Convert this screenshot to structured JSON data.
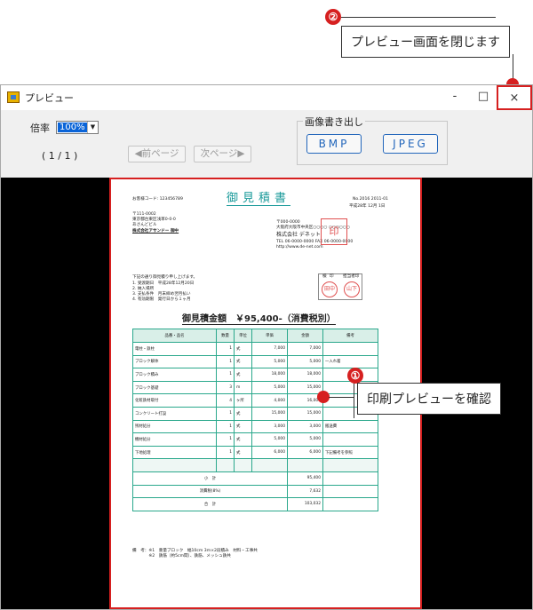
{
  "callouts": [
    {
      "number": "②",
      "text": "プレビュー画面を閉じます"
    },
    {
      "number": "①",
      "text": "印刷プレビューを確認"
    }
  ],
  "window": {
    "title": "プレビュー",
    "controls": {
      "minimize": "-",
      "maximize": "□",
      "close": "×"
    }
  },
  "toolbar": {
    "zoom_label": "倍率",
    "zoom_value": "100%",
    "page_indicator": "( 1 / 1 )",
    "prev_button": "◀前ページ",
    "next_button": "次ページ▶",
    "export_group_title": "画像書き出し",
    "bmp_button": "BMP",
    "jpeg_button": "JPEG"
  },
  "document": {
    "title": "御見積書",
    "customer_code": "お客様コード: 123456789",
    "doc_number": "No.2016 2011-01",
    "date": "平成28年 12月 1日",
    "customer_address": [
      "〒111-0002",
      "東京都台東区浅草0-0-0",
      "あさんどビル",
      "株式会社アサンドー 御中"
    ],
    "company_info": [
      "〒000-0000",
      "大阪府大阪市中央区○○○○ ○○○○○○",
      "株式会社 デネット",
      "TEL 06-0000-0000 FAX 06-0000-0000",
      "http://www.de-net.com"
    ],
    "company_stamp": "印",
    "intro": "下記の通り御見積り申し上げます。",
    "conditions": [
      "1. 受渡期日　平成28年12月20日",
      "2. 納入場所",
      "3. 支払条件　月末締め翌月払い",
      "4. 有効期限　発行日から１ヶ月"
    ],
    "approval_headers": [
      "検",
      "印",
      "担当者印"
    ],
    "approval_stamps": [
      "田中",
      "山下"
    ],
    "total_amount": "御見積金額　￥95,400-（消費税別）",
    "table_headers": [
      "品番・品名",
      "数量",
      "単位",
      "単価",
      "金額",
      "備考"
    ],
    "rows": [
      [
        "電柱・鉄柱",
        "1",
        "式",
        "7,000",
        "7,000",
        ""
      ],
      [
        "ブロック解体",
        "1",
        "式",
        "5,000",
        "5,000",
        "一入れ着"
      ],
      [
        "ブロック積み",
        "1",
        "式",
        "18,000",
        "18,000",
        ""
      ],
      [
        "ブロック基礎",
        "3",
        "m",
        "5,000",
        "15,000",
        ""
      ],
      [
        "化粧鉄材取付",
        "4",
        "ヶ所",
        "4,000",
        "16,000",
        ""
      ],
      [
        "コンクリート打設",
        "1",
        "式",
        "15,000",
        "15,000",
        ""
      ],
      [
        "残材処分",
        "1",
        "式",
        "3,000",
        "3,000",
        "搬送費"
      ],
      [
        "機材処分",
        "1",
        "式",
        "5,000",
        "5,000",
        ""
      ],
      [
        "下地処理",
        "1",
        "式",
        "6,000",
        "6,000",
        "下記備考を参照"
      ],
      [
        "",
        "",
        "",
        "",
        "",
        ""
      ]
    ],
    "subtotal_label": "小　計",
    "subtotal": "95,400",
    "tax_label": "消費税(8%)",
    "tax": "7,632",
    "grand_total_label": "合　計",
    "grand_total": "103,032",
    "remarks": [
      "備　考：※1　重量ブロック　幅10cm 3m×2段積み　材料・工事共",
      "　　　　※2　鉄筋（約5cm間）、鉄筋、メッシュ鉄共"
    ]
  }
}
